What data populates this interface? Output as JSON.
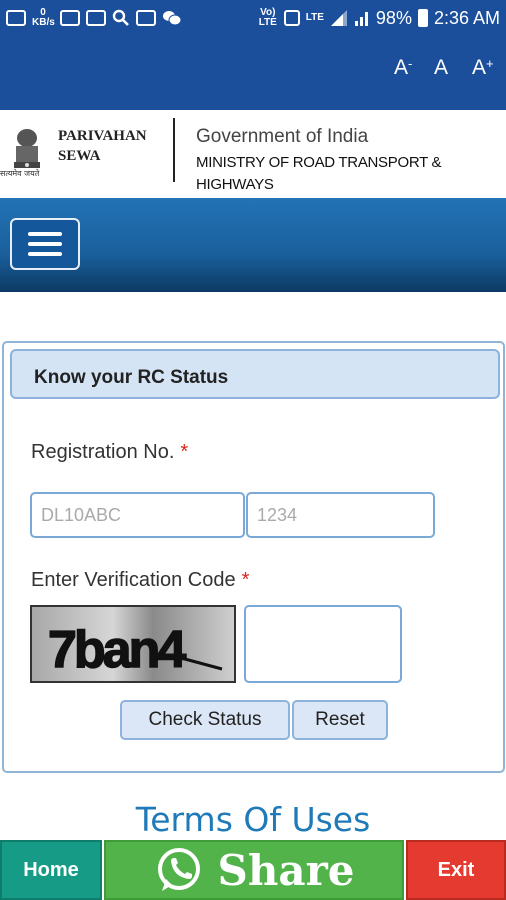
{
  "status_bar": {
    "data_speed": "0 KB/s",
    "volte": "Vo) LTE",
    "lte": "LTE",
    "battery": "98%",
    "time": "2:36 AM"
  },
  "accessibility": {
    "decrease": "A",
    "decrease_sup": "-",
    "normal": "A",
    "increase": "A",
    "increase_sup": "+"
  },
  "header": {
    "emblem_caption": "सत्यमेव जयते",
    "brand_line1": "PARIVAHAN",
    "brand_line2": "SEWA",
    "gov": "Government of India",
    "ministry_line1": "MINISTRY OF ROAD TRANSPORT &",
    "ministry_line2": "HIGHWAYS"
  },
  "form": {
    "title": "Know your RC Status",
    "reg_label": "Registration No.",
    "required_mark": "*",
    "reg_part1_placeholder": "DL10ABC",
    "reg_part2_placeholder": "1234",
    "verify_label": "Enter Verification Code",
    "captcha_text": "7ban4",
    "captcha_input_value": "",
    "check_button": "Check Status",
    "reset_button": "Reset"
  },
  "footer": {
    "terms_link": "Terms Of Uses",
    "home_button": "Home",
    "share_button": "Share",
    "exit_button": "Exit"
  },
  "colors": {
    "brand_blue": "#1b4f9c",
    "home_green": "#159b86",
    "share_green": "#51b34a",
    "exit_red": "#e53a2f",
    "required_red": "#d9251c"
  }
}
